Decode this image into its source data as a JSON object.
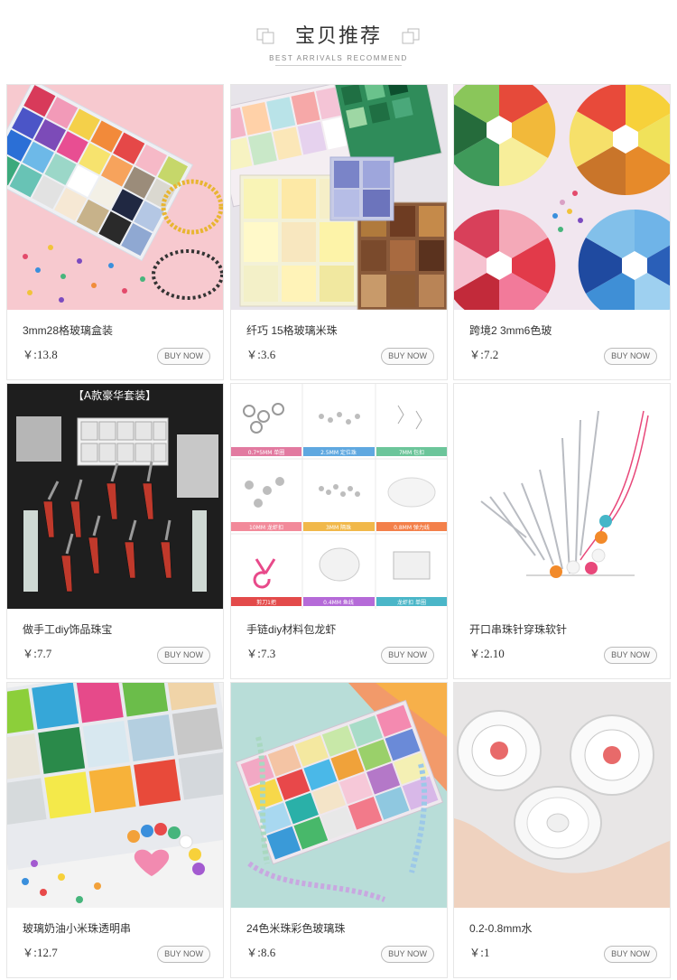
{
  "header": {
    "title": "宝贝推荐",
    "subtitle": "BEST ARRIVALS RECOMMEND"
  },
  "colors": {
    "text": "#333333",
    "border": "#e6e6e6",
    "button_border": "#bbbbbb"
  },
  "products": [
    {
      "name": "3mm28格玻璃盒装",
      "currency": "￥:",
      "price": "13.8",
      "button": "BUY NOW",
      "image": "beads-box-28-grid-photo"
    },
    {
      "name": "纤巧 15格玻璃米珠",
      "currency": "￥:",
      "price": "3.6",
      "button": "BUY NOW",
      "image": "beads-15-grid-boxes-photo"
    },
    {
      "name": "跨境2 3mm6色玻",
      "currency": "￥:",
      "price": "7.2",
      "button": "BUY NOW",
      "image": "six-color-bead-wheels-photo"
    },
    {
      "name": "做手工diy饰品珠宝",
      "currency": "￥:",
      "price": "7.7",
      "button": "BUY NOW",
      "image": "diy-tool-kit-photo",
      "image_text": {
        "banner": "【A款豪华套装】"
      }
    },
    {
      "name": "手链diy材料包龙虾",
      "currency": "￥:",
      "price": "7.3",
      "button": "BUY NOW",
      "image": "findings-grid-photo",
      "image_text": {
        "labels": [
          "0.7*5MM 单圈",
          "2.5MM 定位珠",
          "7MM 包扣",
          "10MM 龙虾扣",
          "3MM 隔珠",
          "0.8MM 弹力线",
          "剪刀1把",
          "0.4MM 鱼线",
          "龙虾扣 单圈"
        ]
      }
    },
    {
      "name": "开口串珠针穿珠软针",
      "currency": "￥:",
      "price": "2.10",
      "button": "BUY NOW",
      "image": "beading-needles-photo"
    },
    {
      "name": "玻璃奶油小米珠透明串",
      "currency": "￥:",
      "price": "12.7",
      "button": "BUY NOW",
      "image": "cream-beads-box-photo"
    },
    {
      "name": "24色米珠彩色玻璃珠",
      "currency": "￥:",
      "price": "8.6",
      "button": "BUY NOW",
      "image": "24-color-beads-box-photo"
    },
    {
      "name": "0.2-0.8mm水",
      "currency": "￥:",
      "price": "1",
      "button": "BUY NOW",
      "image": "elastic-thread-spools-photo"
    }
  ]
}
